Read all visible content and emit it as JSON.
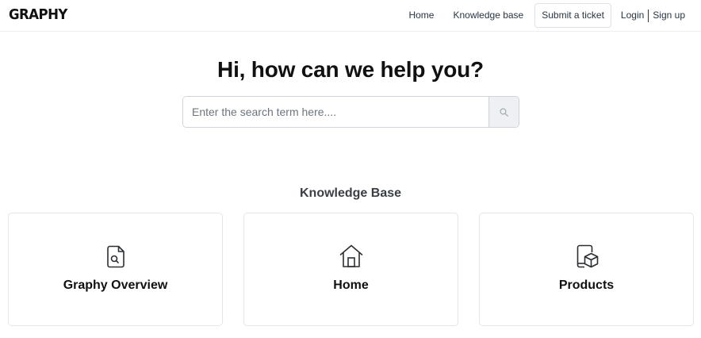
{
  "header": {
    "brand": "GRAPHY",
    "nav": {
      "home": "Home",
      "knowledge_base": "Knowledge base",
      "submit_ticket": "Submit a ticket",
      "login": "Login",
      "signup": "Sign up"
    }
  },
  "hero": {
    "title": "Hi, how can we help you?",
    "search": {
      "placeholder": "Enter the search term here....",
      "value": "",
      "button_icon": "search-icon"
    }
  },
  "knowledge_base": {
    "title": "Knowledge Base",
    "cards": [
      {
        "label": "Graphy Overview",
        "icon": "document-search-icon"
      },
      {
        "label": "Home",
        "icon": "home-icon"
      },
      {
        "label": "Products",
        "icon": "tablet-box-icon"
      }
    ]
  },
  "colors": {
    "text_primary": "#111111",
    "nav_text": "#283543",
    "border": "#e3e6ea",
    "search_button_bg": "#eef0f3"
  }
}
